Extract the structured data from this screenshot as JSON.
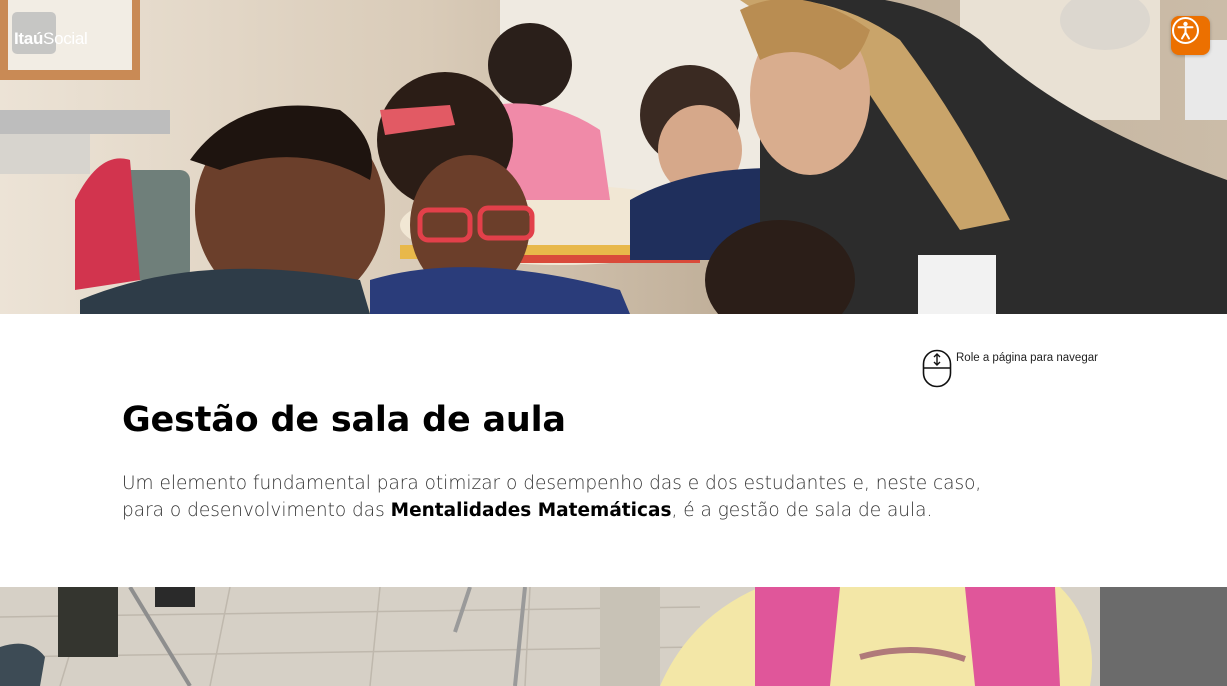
{
  "header": {
    "logo_text_bold": "Itaú",
    "logo_text_light": "Social",
    "hero_image": "classroom-photo",
    "accessibility_button": "accessibility-icon"
  },
  "scroll_hint": {
    "icon": "mouse-scroll-icon",
    "text": "Role a página para navegar"
  },
  "section": {
    "title": "Gestão de sala de aula",
    "intro_part1": "Um elemento fundamental para otimizar o desempenho das e dos estudantes e, neste caso, para o desenvolvimento das ",
    "intro_bold": "Mentalidades Matemáticas",
    "intro_part2": ", é a gestão de sala de aula."
  },
  "bottom_image": "classroom-floor-photo",
  "colors": {
    "accent": "#ec7000",
    "title": "#000000",
    "body_text": "#333333",
    "background": "#ffffff"
  }
}
